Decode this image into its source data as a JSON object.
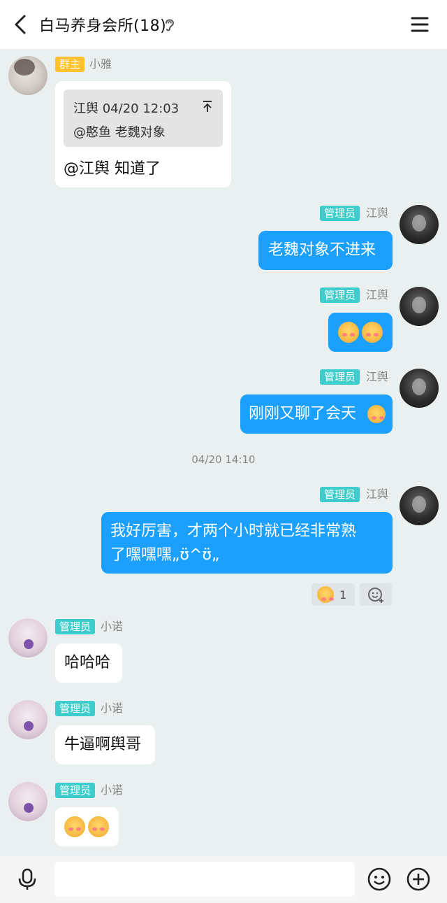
{
  "header": {
    "title": "白马养身会所(18)"
  },
  "messages": [
    {
      "sender": "小雅",
      "role": "群主",
      "quote": {
        "head": "江舆 04/20 12:03",
        "body": "@憨鱼 老魏对象"
      },
      "text": "@江舆 知道了"
    },
    {
      "sender": "江舆",
      "role": "管理员",
      "text": "老魏对象不进来"
    },
    {
      "sender": "江舆",
      "role": "管理员",
      "text": ""
    },
    {
      "sender": "江舆",
      "role": "管理员",
      "text": "刚刚又聊了会天"
    },
    {
      "timestamp": "04/20 14:10"
    },
    {
      "sender": "江舆",
      "role": "管理员",
      "text_line1": "我好厉害，才两个小时就已经非常熟",
      "text_line2": "了嘿嘿嘿„ʊ̈^ʊ̈„",
      "reaction_count": "1"
    },
    {
      "sender": "小诺",
      "role": "管理员",
      "text": "哈哈哈"
    },
    {
      "sender": "小诺",
      "role": "管理员",
      "text": "牛逼啊舆哥"
    },
    {
      "sender": "小诺",
      "role": "管理员",
      "text": ""
    }
  ],
  "input": {
    "placeholder": ""
  },
  "icons": [
    "back-arrow-icon",
    "ear-icon",
    "menu-icon",
    "reply-arrow-icon",
    "add-reaction-icon",
    "mic-icon",
    "emoji-icon",
    "plus-icon"
  ]
}
